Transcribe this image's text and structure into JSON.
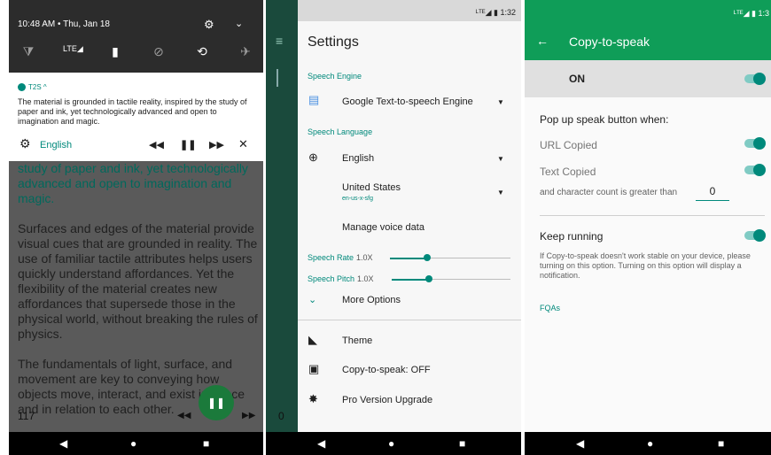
{
  "panel1": {
    "quick_settings": {
      "time_date": "10:48 AM • Thu, Jan 18",
      "gear_icon": "⚙",
      "chevron_icon": "⌄",
      "toggle_icons": [
        "⧩",
        "ᴸᵀᴱ◢",
        "▮",
        "⊘",
        "⟲",
        "✈"
      ],
      "lte_label": "LTE"
    },
    "notification": {
      "app_name": "T2S ^",
      "text": "The material is grounded in tactile reality, inspired by the study of paper and ink, yet technologically advanced and open to imagination and magic.",
      "language": "English"
    },
    "reader": {
      "paragraphs": [
        "study of paper and ink, yet technologically advanced and open to imagination and magic.",
        "Surfaces and edges of the material provide visual cues that are grounded in reality. The use of familiar tactile attributes helps users quickly understand affordances. Yet the flexibility of the material creates new affordances that supersede those in the physical world, without breaking the rules of physics.",
        "The fundamentals of light, surface, and movement are key to conveying how objects move, interact, and exist in space and in relation to each other."
      ],
      "page_number": "117"
    }
  },
  "panel2": {
    "status_time": "1:32",
    "behind_page": "0",
    "title": "Settings",
    "speech_engine_header": "Speech Engine",
    "speech_engine_value": "Google Text-to-speech Engine",
    "speech_language_header": "Speech Language",
    "language_value": "English",
    "region_value": "United States",
    "voice_value": "en-us-x-sfg",
    "manage_voice": "Manage voice data",
    "rate_label": "Speech Rate",
    "rate_value": "1.0X",
    "rate_level": 0.3,
    "pitch_label": "Speech Pitch",
    "pitch_value": "1.0X",
    "pitch_level": 0.3,
    "more_options": "More Options",
    "theme": "Theme",
    "copy_to_speak": "Copy-to-speak: OFF",
    "pro_upgrade": "Pro Version Upgrade"
  },
  "panel3": {
    "status_time": "1:3",
    "title": "Copy-to-speak",
    "on_label": "ON",
    "popup_header": "Pop up speak button when:",
    "url_copied": "URL Copied",
    "text_copied": "Text Copied",
    "char_count_label": "and character count is greater than",
    "char_count_value": "0",
    "keep_running": "Keep running",
    "keep_running_note": "If Copy-to-speak doesn't work stable on your device, please turning on this option. Turning on this option will display a notification.",
    "faqs": "FQAs"
  },
  "colors": {
    "accent": "#00897b",
    "appbar": "#0f9d58",
    "dark": "#2c2c2c"
  }
}
